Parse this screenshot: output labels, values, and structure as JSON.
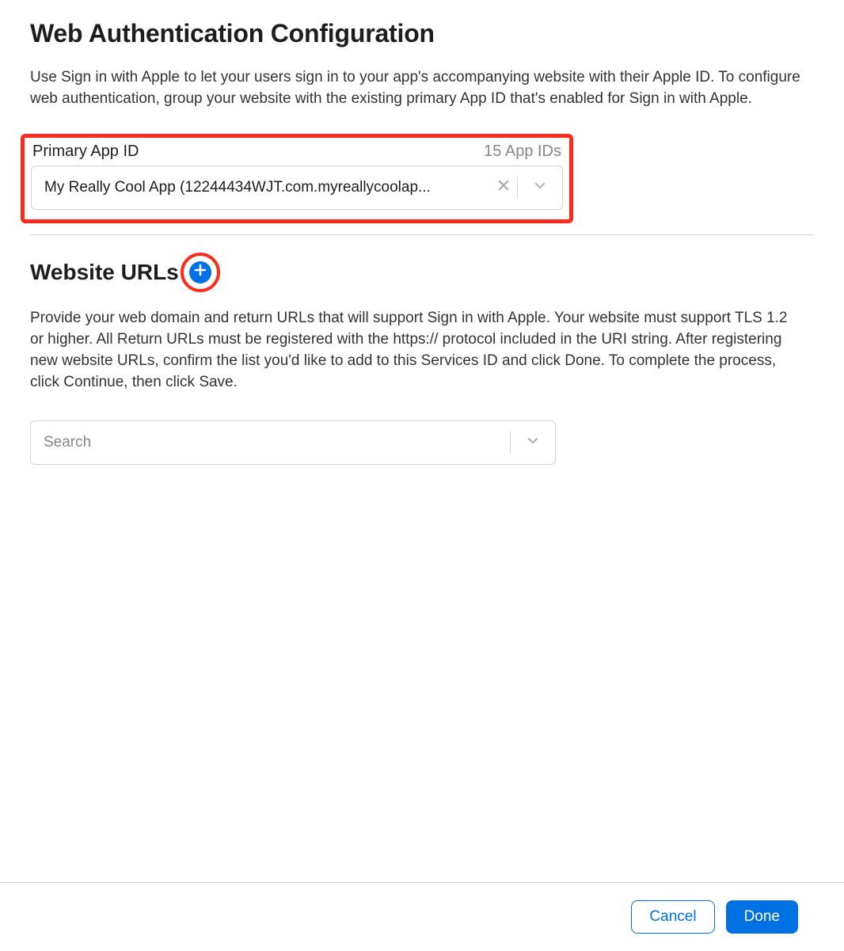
{
  "header": {
    "title": "Web Authentication Configuration",
    "intro": "Use Sign in with Apple to let your users sign in to your app's accompanying website with their Apple ID. To configure web authentication, group your website with the existing primary App ID that's enabled for Sign in with Apple."
  },
  "primary_app": {
    "label": "Primary App ID",
    "count": "15 App IDs",
    "selected": "My Really Cool App (12244434WJT.com.myreallycoolap..."
  },
  "website_urls": {
    "title": "Website URLs",
    "description": "Provide your web domain and return URLs that will support Sign in with Apple. Your website must support TLS 1.2 or higher. All Return URLs must be registered with the https:// protocol included in the URI string. After registering new website URLs, confirm the list you'd like to add to this Services ID and click Done. To complete the process, click Continue, then click Save.",
    "search_placeholder": "Search"
  },
  "footer": {
    "cancel": "Cancel",
    "done": "Done"
  }
}
